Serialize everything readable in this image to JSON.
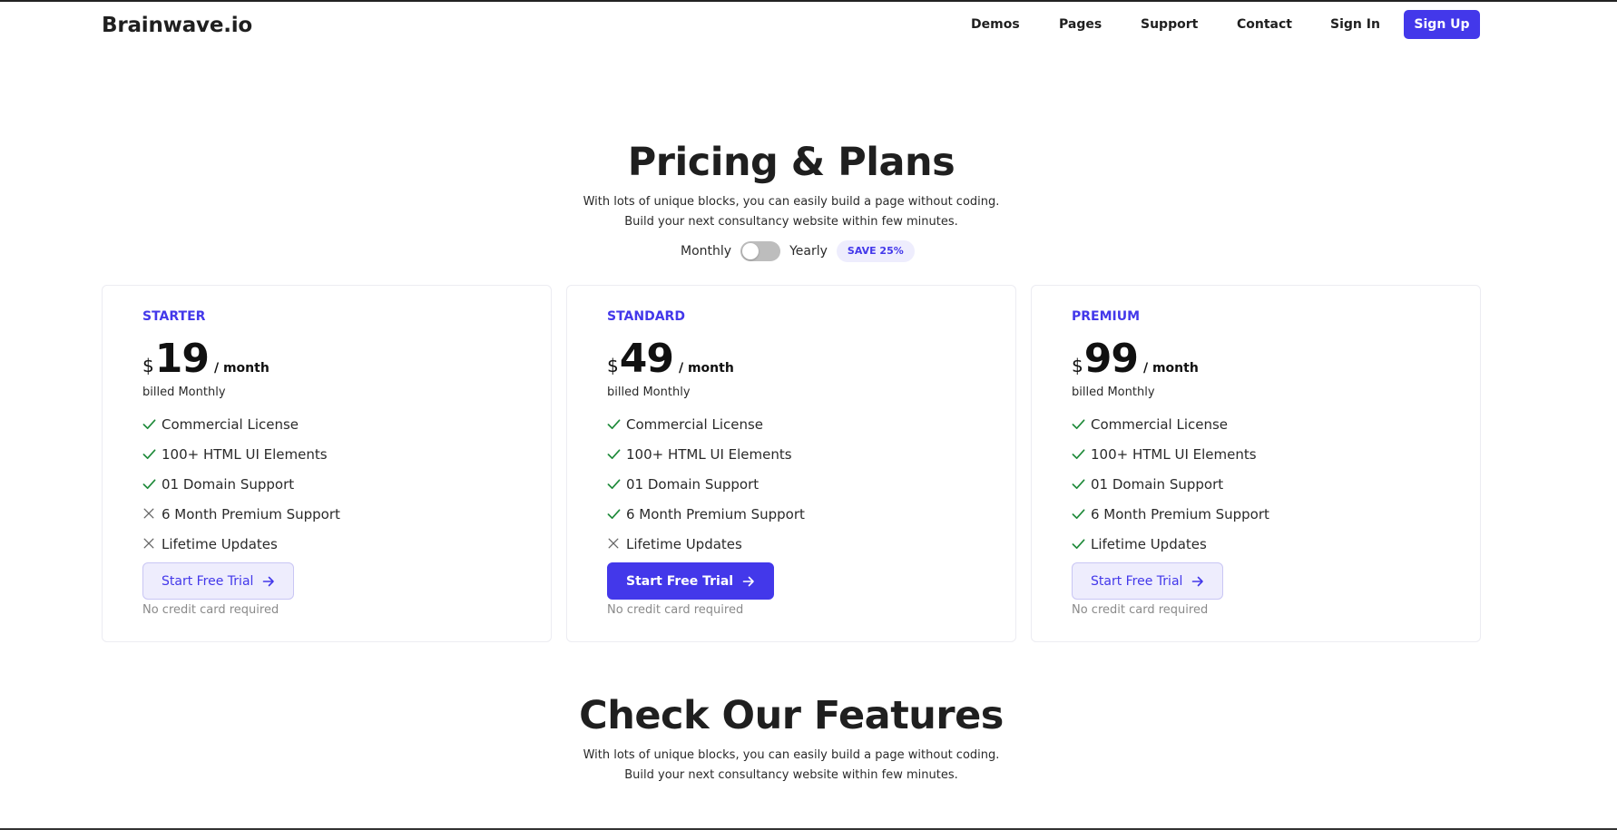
{
  "nav": {
    "brand": "Brainwave.io",
    "links": [
      "Demos",
      "Pages",
      "Support",
      "Contact",
      "Sign In"
    ],
    "signup_label": "Sign Up"
  },
  "pricing": {
    "title": "Pricing & Plans",
    "subtitle_line1": "With lots of unique blocks, you can easily build a page without coding.",
    "subtitle_line2": "Build your next consultancy website within few minutes.",
    "toggle_monthly": "Monthly",
    "toggle_yearly": "Yearly",
    "toggle_state": "monthly",
    "save_badge": "SAVE 25%"
  },
  "plans": [
    {
      "name": "STARTER",
      "currency": "$",
      "amount": "19",
      "period": "/ month",
      "billed": "billed Monthly",
      "features": [
        {
          "label": "Commercial License",
          "included": true
        },
        {
          "label": "100+ HTML UI Elements",
          "included": true
        },
        {
          "label": "01 Domain Support",
          "included": true
        },
        {
          "label": "6 Month Premium Support",
          "included": false
        },
        {
          "label": "Lifetime Updates",
          "included": false
        }
      ],
      "cta": "Start Free Trial",
      "cta_style": "light",
      "note": "No credit card required"
    },
    {
      "name": "STANDARD",
      "currency": "$",
      "amount": "49",
      "period": "/ month",
      "billed": "billed Monthly",
      "features": [
        {
          "label": "Commercial License",
          "included": true
        },
        {
          "label": "100+ HTML UI Elements",
          "included": true
        },
        {
          "label": "01 Domain Support",
          "included": true
        },
        {
          "label": "6 Month Premium Support",
          "included": true
        },
        {
          "label": "Lifetime Updates",
          "included": false
        }
      ],
      "cta": "Start Free Trial",
      "cta_style": "dark",
      "note": "No credit card required"
    },
    {
      "name": "PREMIUM",
      "currency": "$",
      "amount": "99",
      "period": "/ month",
      "billed": "billed Monthly",
      "features": [
        {
          "label": "Commercial License",
          "included": true
        },
        {
          "label": "100+ HTML UI Elements",
          "included": true
        },
        {
          "label": "01 Domain Support",
          "included": true
        },
        {
          "label": "6 Month Premium Support",
          "included": true
        },
        {
          "label": "Lifetime Updates",
          "included": true
        }
      ],
      "cta": "Start Free Trial",
      "cta_style": "light",
      "note": "No credit card required"
    }
  ],
  "features_section": {
    "title": "Check Our Features",
    "subtitle_line1": "With lots of unique blocks, you can easily build a page without coding.",
    "subtitle_line2": "Build your next consultancy website within few minutes."
  },
  "colors": {
    "accent": "#4338ea",
    "accent_soft": "#eeedfd",
    "check": "#1f8a3a",
    "cross": "#666666"
  },
  "icons": {
    "included": "check-icon",
    "excluded": "x-icon",
    "cta": "arrow-right-icon"
  }
}
